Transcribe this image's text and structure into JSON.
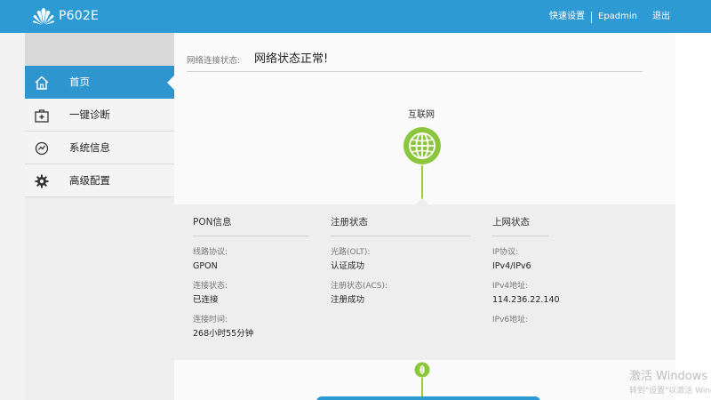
{
  "header": {
    "model": "P602E",
    "quick_setup": "快速设置",
    "user": "Epadmin",
    "logout": "退出"
  },
  "sidebar": {
    "items": [
      {
        "label": "首页",
        "icon": "home-icon",
        "active": true
      },
      {
        "label": "一键诊断",
        "icon": "first-aid-icon",
        "active": false
      },
      {
        "label": "系统信息",
        "icon": "gauge-icon",
        "active": false
      },
      {
        "label": "高级配置",
        "icon": "gear-icon",
        "active": false
      }
    ]
  },
  "main": {
    "connection_label": "网络连接状态:",
    "connection_value": "网络状态正常!",
    "internet_label": "互联网",
    "pon": {
      "title": "PON信息",
      "fields": [
        {
          "key": "线路协议:",
          "value": "GPON"
        },
        {
          "key": "连接状态:",
          "value": "已连接"
        },
        {
          "key": "连接时间:",
          "value": "268小时55分钟"
        }
      ]
    },
    "registration": {
      "title": "注册状态",
      "fields": [
        {
          "key": "光路(OLT):",
          "value": "认证成功"
        },
        {
          "key": "注册状态(ACS):",
          "value": "注册成功"
        }
      ]
    },
    "uplink": {
      "title": "上网状态",
      "fields": [
        {
          "key": "IP协议:",
          "value": "IPv4/IPv6"
        },
        {
          "key": "IPv4地址:",
          "value": "114.236.22.140"
        },
        {
          "key": "IPv6地址:",
          "value": ""
        }
      ]
    }
  },
  "watermark": {
    "line1": "激活 Windows",
    "line2": "转到\"设置\"以激活 Windows。"
  },
  "colors": {
    "accent": "#2e9ad3",
    "globe": "#8cc63f"
  }
}
